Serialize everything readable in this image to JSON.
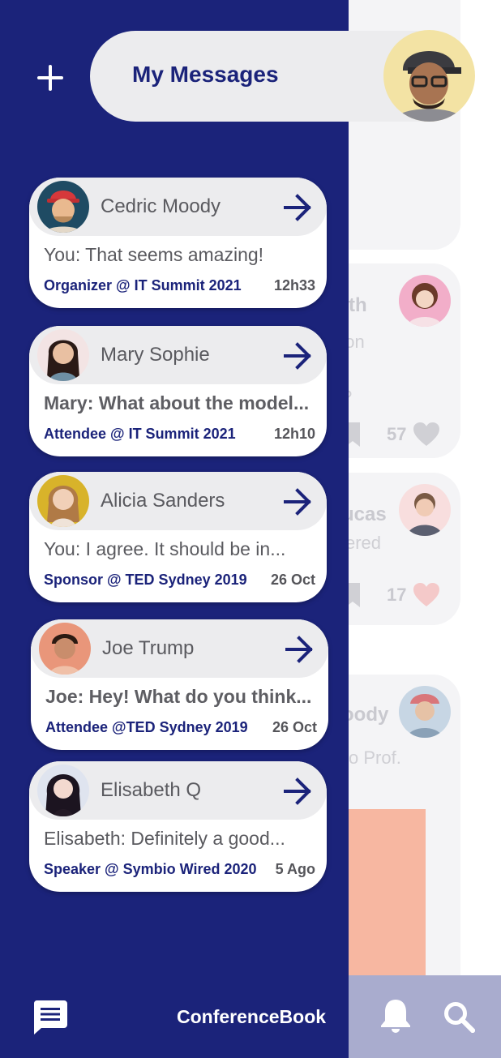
{
  "header": {
    "title": "My Messages",
    "add_icon": "plus-icon",
    "profile_icon": "user-avatar"
  },
  "conversations": [
    {
      "name": "Cedric Moody",
      "last_message": "You: That seems amazing!",
      "unread": false,
      "role": "Organizer @ IT Summit 2021",
      "time": "12h33"
    },
    {
      "name": "Mary Sophie",
      "last_message": "Mary: What about the model...",
      "unread": true,
      "role": "Attendee @ IT Summit 2021",
      "time": "12h10"
    },
    {
      "name": "Alicia Sanders",
      "last_message": "You: I agree. It should be in...",
      "unread": false,
      "role": "Sponsor @ TED Sydney 2019",
      "time": "26 Oct"
    },
    {
      "name": "Joe Trump",
      "last_message": "Joe: Hey! What do you think...",
      "unread": true,
      "role": "Attendee @TED Sydney 2019",
      "time": "26 Oct"
    },
    {
      "name": "Elisabeth Q",
      "last_message": "Elisabeth: Definitely a good...",
      "unread": false,
      "role": "Speaker @ Symbio Wired 2020",
      "time": "5 Ago"
    }
  ],
  "background_feed": [
    {
      "name_fragment": "mith",
      "lines": [
        "ation",
        "?"
      ],
      "likes": "57"
    },
    {
      "name_fragment": "ucas",
      "lines": [
        "ered"
      ],
      "likes": "17"
    },
    {
      "name_fragment": "oody",
      "lines": [
        "o Prof."
      ]
    }
  ],
  "bottom_bar": {
    "brand": "ConferenceBook",
    "icons": [
      "chat-icon",
      "bell-icon",
      "search-icon"
    ]
  },
  "colors": {
    "primary": "#1b237a",
    "drawer_bg": "#1b237a",
    "card_bg": "#ffffff",
    "card_header_bg": "#ececee",
    "bottom_bar_light": "#a9acce",
    "like_heart": "#f4c9c9"
  }
}
